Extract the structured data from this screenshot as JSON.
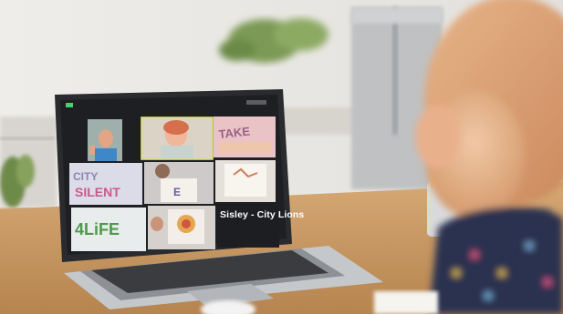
{
  "photo": {
    "caption": "Sisley - City Lions",
    "colors": {
      "wall": "#e9e7e3",
      "desk": "#c99a66",
      "laptop": "#b9bcc0",
      "screen_bg": "#1f1f22",
      "child_hair": "#d89a6e",
      "child_shirt": "#2a2f4a"
    }
  }
}
